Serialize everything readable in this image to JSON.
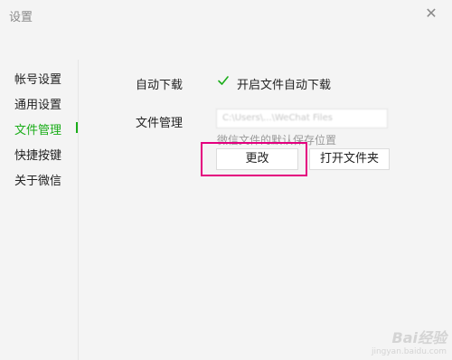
{
  "window": {
    "title": "设置",
    "close_icon": "close-icon"
  },
  "sidebar": {
    "items": [
      {
        "label": "帐号设置",
        "active": false
      },
      {
        "label": "通用设置",
        "active": false
      },
      {
        "label": "文件管理",
        "active": true
      },
      {
        "label": "快捷按键",
        "active": false
      },
      {
        "label": "关于微信",
        "active": false
      }
    ]
  },
  "settings": {
    "auto_download": {
      "label": "自动下载",
      "option_label": "开启文件自动下载",
      "checked": true
    },
    "file_management": {
      "label": "文件管理",
      "path_value": "C:\\Users\\...\\WeChat Files",
      "hint": "微信文件的默认保存位置",
      "change_button": "更改",
      "open_folder_button": "打开文件夹"
    }
  },
  "colors": {
    "accent": "#1aad19",
    "highlight": "#e4007f"
  },
  "watermark": {
    "logo": "Bai经验",
    "url": "jingyan.baidu.com"
  }
}
